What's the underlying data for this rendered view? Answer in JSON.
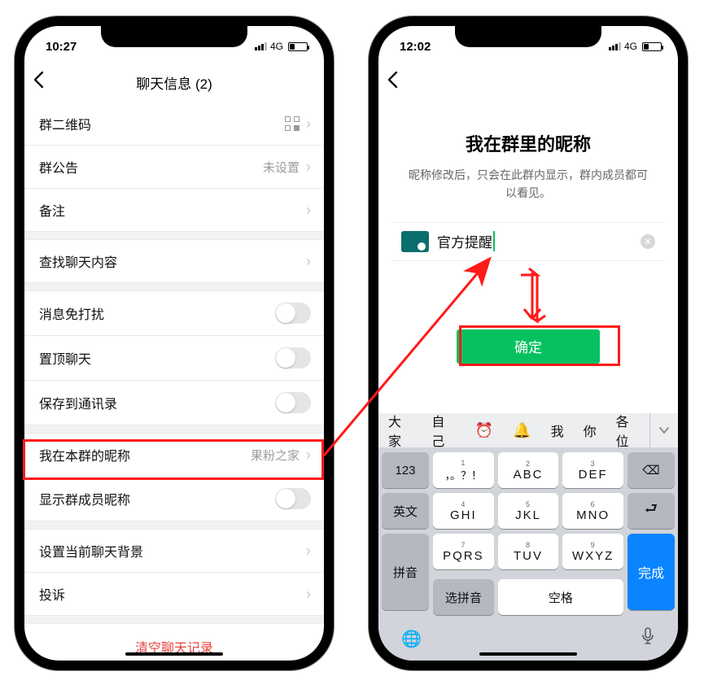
{
  "leftPhone": {
    "status": {
      "time": "10:27",
      "network": "4G"
    },
    "nav": {
      "title": "聊天信息 (2)"
    },
    "cells": {
      "qr": {
        "label": "群二维码"
      },
      "notice": {
        "label": "群公告",
        "value": "未设置"
      },
      "remark": {
        "label": "备注"
      },
      "search": {
        "label": "查找聊天内容"
      },
      "mute": {
        "label": "消息免打扰"
      },
      "sticky": {
        "label": "置顶聊天"
      },
      "save": {
        "label": "保存到通讯录"
      },
      "nickname": {
        "label": "我在本群的昵称",
        "value": "果粉之家"
      },
      "showNick": {
        "label": "显示群成员昵称"
      },
      "background": {
        "label": "设置当前聊天背景"
      },
      "complaint": {
        "label": "投诉"
      },
      "clear": {
        "label": "清空聊天记录"
      }
    }
  },
  "rightPhone": {
    "status": {
      "time": "12:02",
      "network": "4G"
    },
    "page": {
      "title": "我在群里的昵称",
      "desc": "昵称修改后，只会在此群内显示，群内成员都可以看见。",
      "input_value": "官方提醒",
      "confirm": "确定"
    },
    "keyboard": {
      "suggestions": [
        "大家",
        "自己",
        "⏰",
        "🔔",
        "我",
        "你",
        "各位"
      ],
      "sideLeft": [
        "123",
        "英文",
        "拼音"
      ],
      "grid": [
        [
          "，。？！",
          "ABC",
          "DEF"
        ],
        [
          "GHI",
          "JKL",
          "MNO"
        ],
        [
          "PQRS",
          "TUV",
          "WXYZ"
        ],
        [
          "选拼音",
          "空格"
        ]
      ],
      "gridSub": [
        [
          "1",
          "2",
          "3"
        ],
        [
          "4",
          "5",
          "6"
        ],
        [
          "7",
          "8",
          "9"
        ]
      ],
      "sideRight": {
        "backspace": "⌫",
        "confirm": "⮐",
        "done": "完成"
      }
    }
  }
}
